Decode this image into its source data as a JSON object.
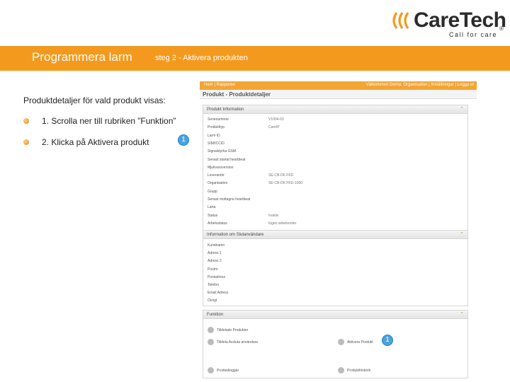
{
  "brand": {
    "name": "CareTech",
    "registered": "®",
    "tagline": "Call for care",
    "accent": "#f39a1e"
  },
  "slide": {
    "title": "Programmera larm",
    "subtitle": "steg 2 - Aktivera produkten",
    "intro": "Produktdetaljer för vald produkt visas:",
    "steps": [
      {
        "text": "1. Scrolla ner till rubriken ”Funktion”"
      },
      {
        "text": "2. Klicka på Aktivera produkt",
        "callout": "1"
      }
    ]
  },
  "app": {
    "nav": {
      "left": "Hem | Rapporter",
      "right": "Välkommen Demo: Organisation | Inställningar | Logga ut"
    },
    "page_title": "Produkt - Produktdetaljer",
    "product_info": {
      "title": "Produkt Information",
      "rows": [
        {
          "label": "Serienummer",
          "value": "V1004-03"
        },
        {
          "label": "Produkttyp",
          "value": "CareIP"
        },
        {
          "label": "Larm ID",
          "value": ""
        },
        {
          "label": "SIM/ICCID",
          "value": ""
        },
        {
          "label": "Signalstyrka GSM",
          "value": ""
        },
        {
          "label": "Senast startat heartbeat",
          "value": ""
        },
        {
          "label": "Mjukvaruversion",
          "value": ""
        },
        {
          "label": "Leverantör",
          "value": "SE-CB-DK FKD"
        },
        {
          "label": "Organisation",
          "value": "SE-CB-DK FKD-1000"
        },
        {
          "label": "Grupp",
          "value": ""
        },
        {
          "label": "Senast mottagna heartbeat",
          "value": ""
        },
        {
          "label": "Larta",
          "value": ""
        },
        {
          "label": "Status",
          "value": "Inaktiv"
        },
        {
          "label": "Arbetsstatus",
          "value": "Ingen arbetsorder"
        }
      ]
    },
    "end_user": {
      "title": "Information om Slutanvändare",
      "rows": [
        "Kundnamn",
        "Adress 1",
        "Adress 2",
        "Postnr",
        "Postadress",
        "Telefon",
        "Email Adress",
        "Övrigt"
      ]
    },
    "function": {
      "title": "Funktion",
      "items": {
        "assigned": "Tilldelade Produkter",
        "assign_end_user": "Tilldela Avsluta användare",
        "activate": "Aktivera Produkt",
        "logs": "Produktloggar",
        "history": "Produkthistorik"
      },
      "callout": "1"
    }
  }
}
